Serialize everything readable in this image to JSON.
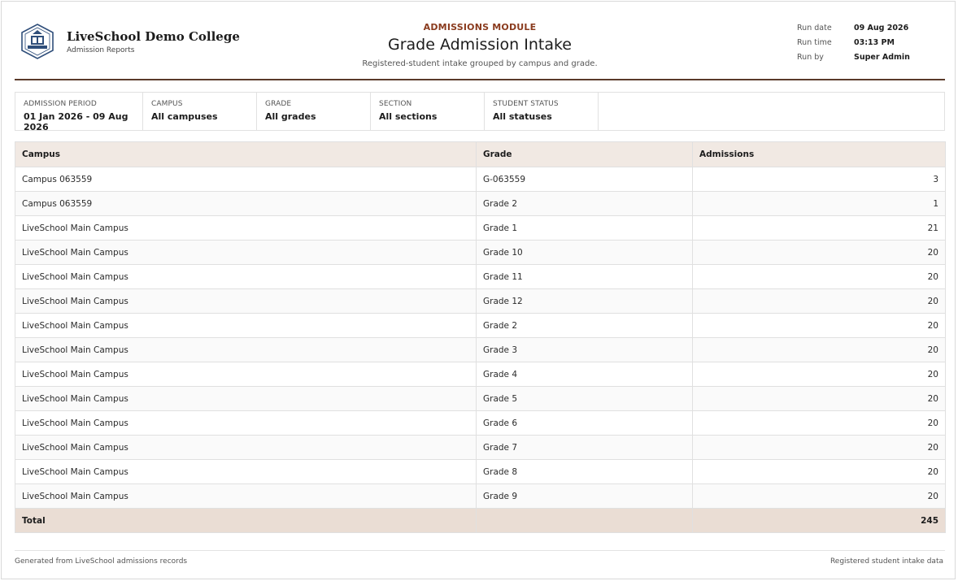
{
  "header": {
    "college_name": "LiveSchool Demo College",
    "college_sub": "Admission Reports",
    "module_label": "ADMISSIONS MODULE",
    "title": "Grade Admission Intake",
    "description": "Registered-student intake grouped by campus and grade.",
    "run": [
      {
        "key": "Run date",
        "value": "09 Aug 2026"
      },
      {
        "key": "Run time",
        "value": "03:13 PM"
      },
      {
        "key": "Run by",
        "value": "Super Admin"
      }
    ]
  },
  "filters": [
    {
      "label": "ADMISSION PERIOD",
      "value": "01 Jan 2026 - 09 Aug 2026"
    },
    {
      "label": "CAMPUS",
      "value": "All campuses"
    },
    {
      "label": "GRADE",
      "value": "All grades"
    },
    {
      "label": "SECTION",
      "value": "All sections"
    },
    {
      "label": "STUDENT STATUS",
      "value": "All statuses"
    }
  ],
  "table": {
    "columns": [
      "Campus",
      "Grade",
      "Admissions"
    ],
    "rows": [
      [
        "Campus 063559",
        "G-063559",
        "3"
      ],
      [
        "Campus 063559",
        "Grade 2",
        "1"
      ],
      [
        "LiveSchool Main Campus",
        "Grade 1",
        "21"
      ],
      [
        "LiveSchool Main Campus",
        "Grade 10",
        "20"
      ],
      [
        "LiveSchool Main Campus",
        "Grade 11",
        "20"
      ],
      [
        "LiveSchool Main Campus",
        "Grade 12",
        "20"
      ],
      [
        "LiveSchool Main Campus",
        "Grade 2",
        "20"
      ],
      [
        "LiveSchool Main Campus",
        "Grade 3",
        "20"
      ],
      [
        "LiveSchool Main Campus",
        "Grade 4",
        "20"
      ],
      [
        "LiveSchool Main Campus",
        "Grade 5",
        "20"
      ],
      [
        "LiveSchool Main Campus",
        "Grade 6",
        "20"
      ],
      [
        "LiveSchool Main Campus",
        "Grade 7",
        "20"
      ],
      [
        "LiveSchool Main Campus",
        "Grade 8",
        "20"
      ],
      [
        "LiveSchool Main Campus",
        "Grade 9",
        "20"
      ]
    ],
    "total_label": "Total",
    "total_value": "245"
  },
  "footer": {
    "left": "Generated from LiveSchool admissions records",
    "right": "Registered student intake data"
  },
  "colors": {
    "accent": "#8a3b1e",
    "header_rule": "#5a3a2a",
    "table_head_bg": "#f1e9e3",
    "total_bg": "#eaddd4"
  }
}
